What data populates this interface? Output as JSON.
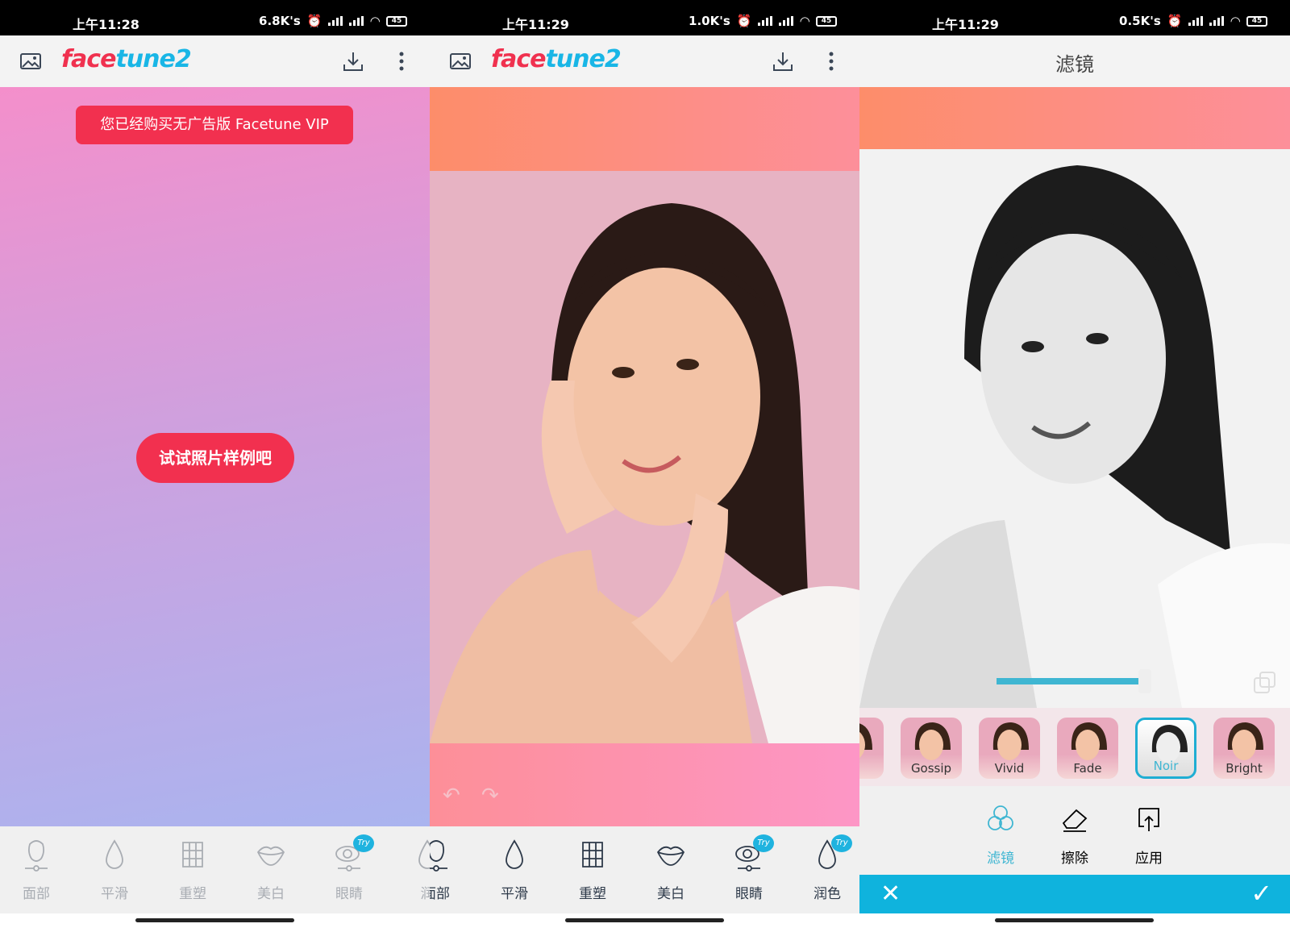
{
  "screens": [
    {
      "status": {
        "time": "上午11:28",
        "speed": "6.8K's",
        "battery": "45"
      },
      "header": {
        "logo_part1": "face",
        "logo_part2": "tune2"
      },
      "vip_banner": "您已经购买无广告版 Facetune VIP",
      "sample_button": "试试照片样例吧",
      "tools": [
        {
          "label": "面部",
          "icon": "face-icon"
        },
        {
          "label": "平滑",
          "icon": "drop-icon"
        },
        {
          "label": "重塑",
          "icon": "grid-icon"
        },
        {
          "label": "美白",
          "icon": "lips-icon"
        },
        {
          "label": "眼睛",
          "icon": "eye-icon",
          "badge": "Try"
        },
        {
          "label": "润",
          "icon": "drop-icon"
        }
      ]
    },
    {
      "status": {
        "time": "上午11:29",
        "speed": "1.0K's",
        "battery": "45"
      },
      "header": {
        "logo_part1": "face",
        "logo_part2": "tune2"
      },
      "tools": [
        {
          "label": "面部",
          "icon": "face-icon"
        },
        {
          "label": "平滑",
          "icon": "drop-icon"
        },
        {
          "label": "重塑",
          "icon": "grid-icon"
        },
        {
          "label": "美白",
          "icon": "lips-icon"
        },
        {
          "label": "眼睛",
          "icon": "eye-icon",
          "badge": "Try"
        },
        {
          "label": "润色",
          "icon": "drop-icon",
          "badge": "Try"
        }
      ]
    },
    {
      "status": {
        "time": "上午11:29",
        "speed": "0.5K's",
        "battery": "45"
      },
      "header": {
        "title": "滤镜"
      },
      "filter_strength": 0.75,
      "filters": [
        {
          "label": "sé"
        },
        {
          "label": "Gossip"
        },
        {
          "label": "Vivid"
        },
        {
          "label": "Fade"
        },
        {
          "label": "Noir",
          "selected": true
        },
        {
          "label": "Bright"
        }
      ],
      "tools": [
        {
          "label": "滤镜",
          "icon": "filter-icon",
          "active": true
        },
        {
          "label": "擦除",
          "icon": "eraser-icon"
        },
        {
          "label": "应用",
          "icon": "apply-icon"
        }
      ]
    }
  ],
  "colors": {
    "accent_red": "#f2304f",
    "accent_blue": "#19b6e6",
    "action_bar": "#0fb3dd"
  }
}
